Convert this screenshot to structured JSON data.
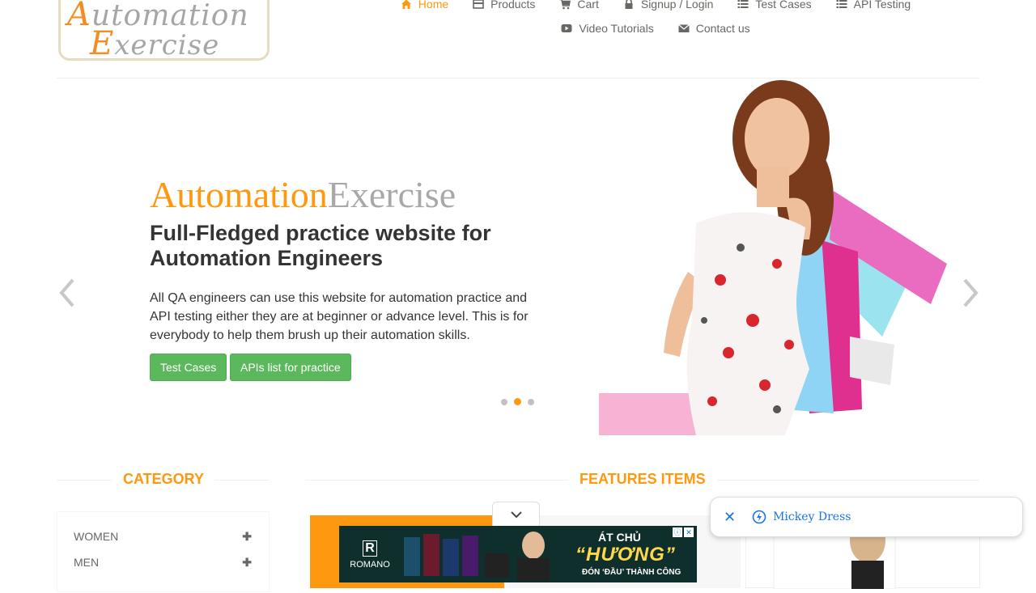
{
  "logo": {
    "line1_cap": "A",
    "line1_rest": "utomation",
    "line2_cap": "E",
    "line2_rest": "xercise"
  },
  "nav": {
    "row1": [
      {
        "label": "Home",
        "icon": "home-icon",
        "active": true
      },
      {
        "label": "Products",
        "icon": "card-icon"
      },
      {
        "label": "Cart",
        "icon": "cart-icon"
      },
      {
        "label": "Signup / Login",
        "icon": "lock-icon"
      },
      {
        "label": "Test Cases",
        "icon": "list-icon"
      },
      {
        "label": "API Testing",
        "icon": "list-icon"
      }
    ],
    "row2": [
      {
        "label": "Video Tutorials",
        "icon": "youtube-icon"
      },
      {
        "label": "Contact us",
        "icon": "envelope-icon"
      }
    ]
  },
  "slider": {
    "brand_a": "Automation",
    "brand_b": "Exercise",
    "headline": "Full-Fledged practice website for Automation Engineers",
    "description": "All QA engineers can use this website for automation practice and API testing either they are at beginner or advance level. This is for everybody to help them brush up their automation skills.",
    "btn_test_cases": "Test Cases",
    "btn_apis": "APIs list for practice",
    "active_dot": 1,
    "dot_count": 3
  },
  "sections": {
    "category": "CATEGORY",
    "features": "FEATURES ITEMS"
  },
  "categories": [
    {
      "label": "WOMEN"
    },
    {
      "label": "MEN"
    }
  ],
  "ad": {
    "brand": "ROMANO",
    "at": "ÁT CHỦ",
    "huong": "“HƯƠNG”",
    "tag": "ĐÓN ‘ĐẦU’ THÀNH CÔNG"
  },
  "popup": {
    "label": "Mickey Dress"
  },
  "colors": {
    "accent": "#fe980f",
    "button": "#5cb85c",
    "text": "#696763",
    "link_blue": "#1a73e8"
  }
}
